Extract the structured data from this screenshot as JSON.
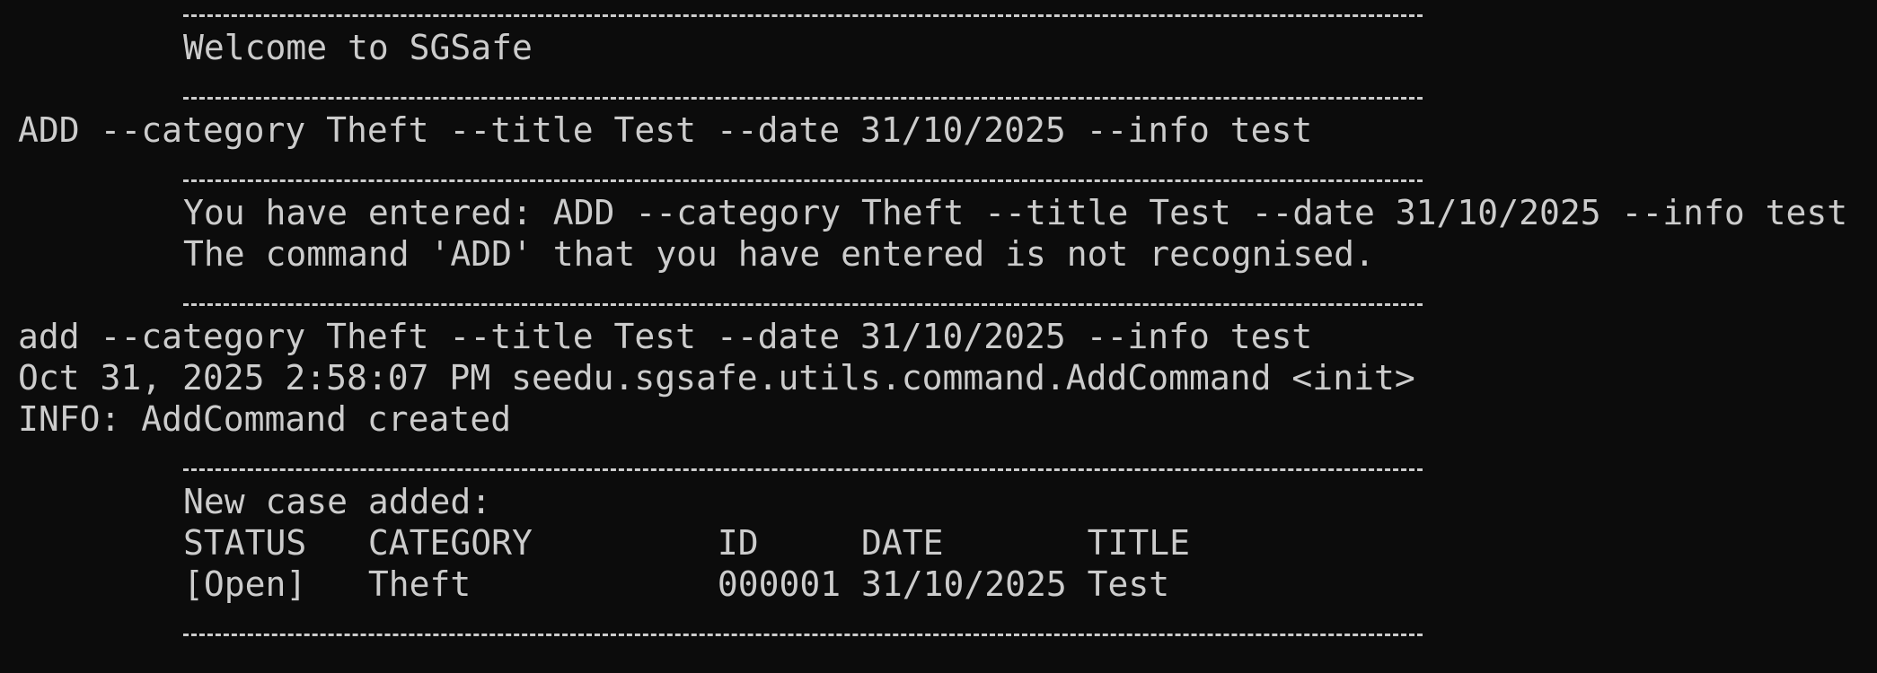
{
  "terminal": {
    "welcome": "Welcome to SGSafe",
    "input_1": "ADD --category Theft --title Test --date 31/10/2025 --info test",
    "echo_1": "You have entered: ADD --category Theft --title Test --date 31/10/2025 --info test",
    "error_1": "The command 'ADD' that you have entered is not recognised.",
    "input_2": "add --category Theft --title Test --date 31/10/2025 --info test",
    "log_timestamp": "Oct 31, 2025 2:58:07 PM seedu.sgsafe.utils.command.AddCommand <init>",
    "log_info": "INFO: AddCommand created",
    "added_message": "New case added:",
    "table_header": "STATUS   CATEGORY         ID     DATE       TITLE",
    "table_row": "[Open]   Theft            000001 31/10/2025 Test"
  },
  "colors": {
    "background": "#0c0c0c",
    "foreground": "#cccccc"
  }
}
